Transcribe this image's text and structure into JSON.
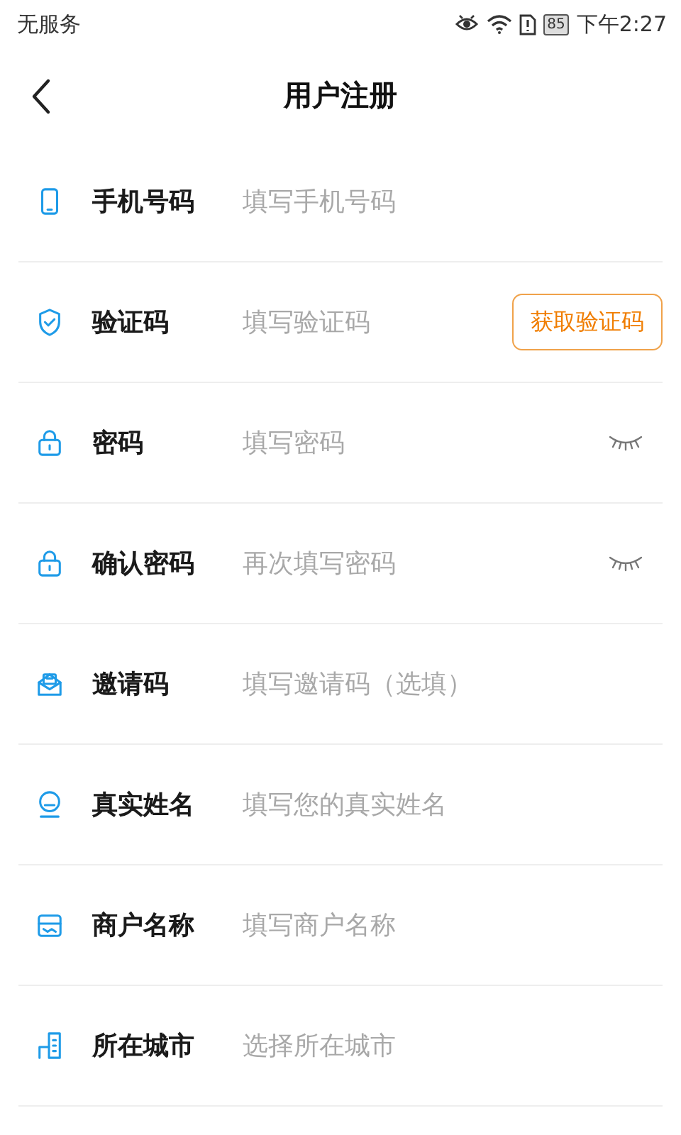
{
  "status_bar": {
    "carrier": "无服务",
    "battery": "85",
    "time": "下午2:27"
  },
  "nav": {
    "title": "用户注册"
  },
  "fields": [
    {
      "kind": "plain",
      "label": "手机号码",
      "placeholder": "填写手机号码"
    },
    {
      "kind": "code",
      "label": "验证码",
      "placeholder": "填写验证码",
      "button": "获取验证码"
    },
    {
      "kind": "password",
      "label": "密码",
      "placeholder": "填写密码"
    },
    {
      "kind": "password",
      "label": "确认密码",
      "placeholder": "再次填写密码"
    },
    {
      "kind": "plain",
      "label": "邀请码",
      "placeholder": "填写邀请码（选填）"
    },
    {
      "kind": "plain",
      "label": "真实姓名",
      "placeholder": "填写您的真实姓名"
    },
    {
      "kind": "plain",
      "label": "商户名称",
      "placeholder": "填写商户名称"
    },
    {
      "kind": "plain",
      "label": "所在城市",
      "placeholder": "选择所在城市"
    }
  ]
}
